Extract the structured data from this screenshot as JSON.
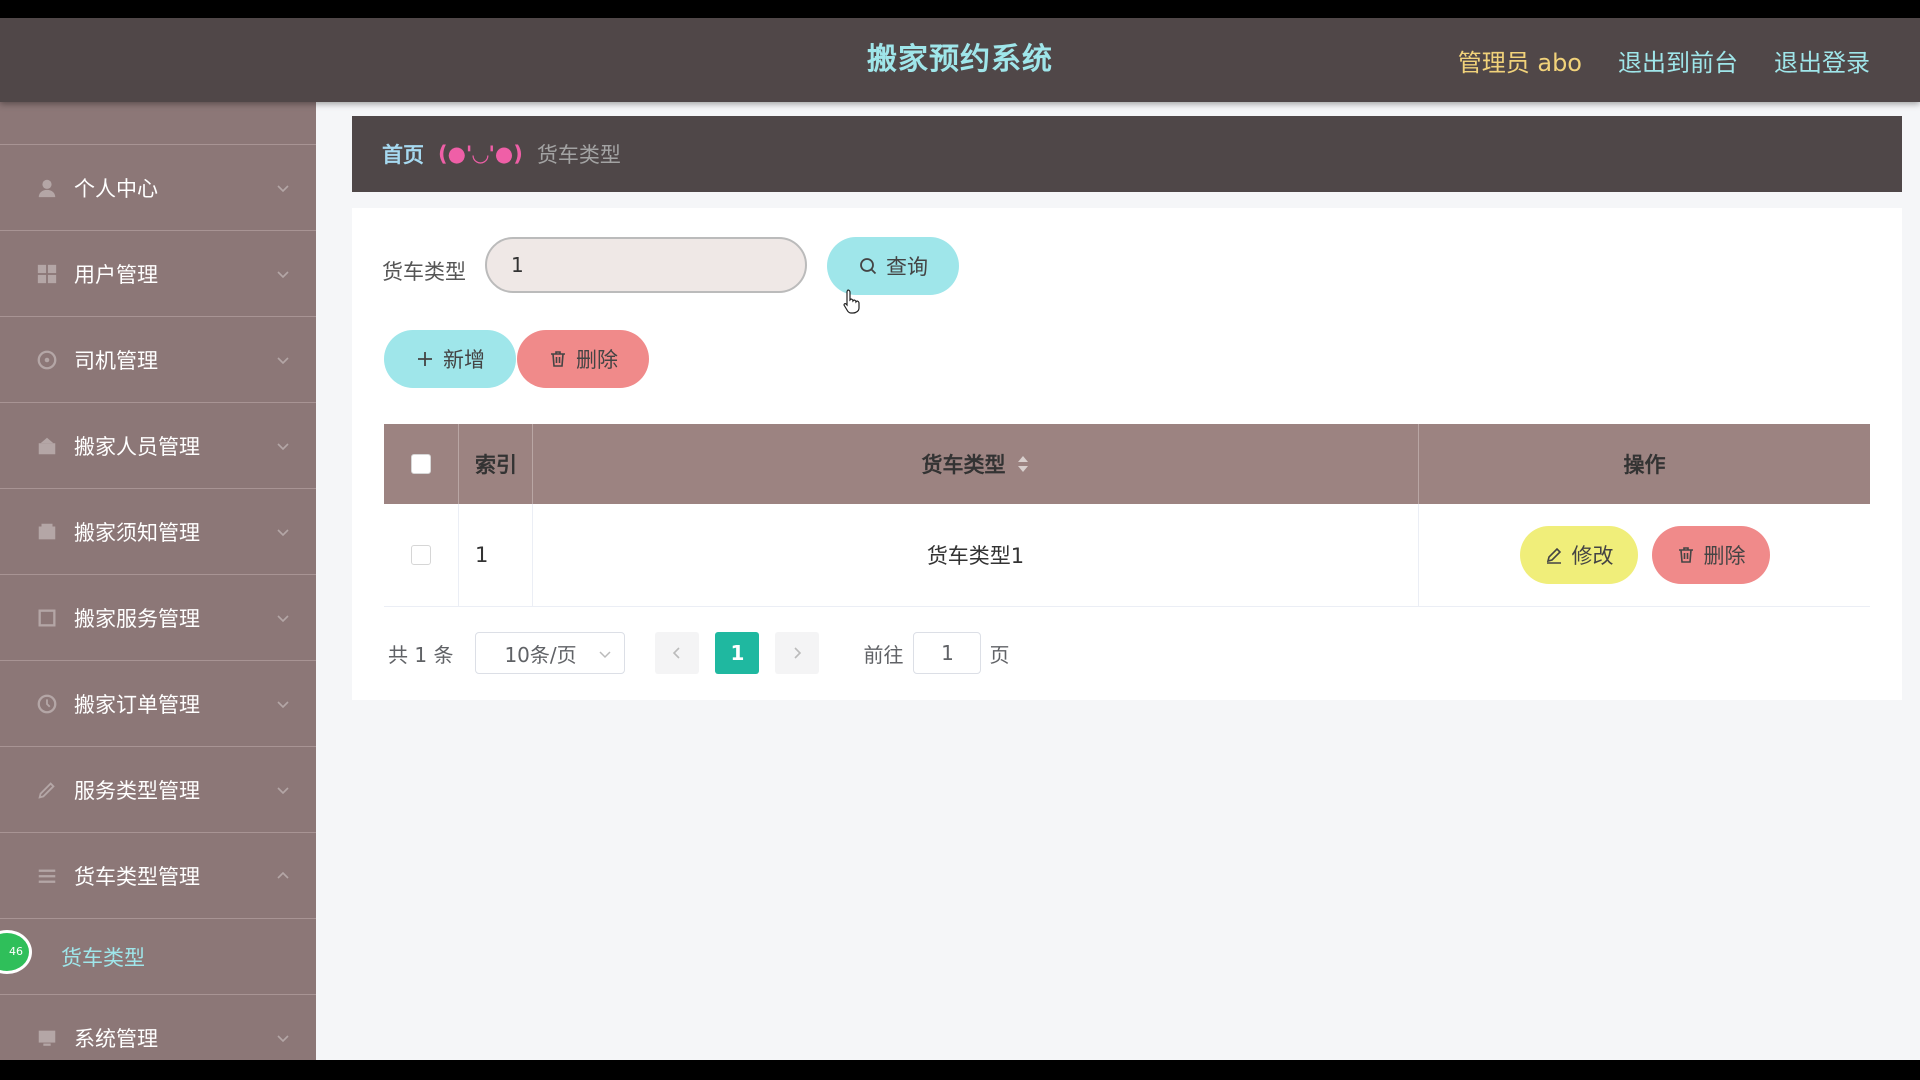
{
  "header": {
    "title": "搬家预约系统",
    "admin_label": "管理员 abo",
    "front_link": "退出到前台",
    "logout_link": "退出登录"
  },
  "sidebar": {
    "items": [
      {
        "label": "个人中心",
        "icon": "user-icon"
      },
      {
        "label": "用户管理",
        "icon": "grid-icon"
      },
      {
        "label": "司机管理",
        "icon": "steering-icon"
      },
      {
        "label": "搬家人员管理",
        "icon": "worker-icon"
      },
      {
        "label": "搬家须知管理",
        "icon": "notice-icon"
      },
      {
        "label": "搬家服务管理",
        "icon": "service-icon"
      },
      {
        "label": "搬家订单管理",
        "icon": "order-icon"
      },
      {
        "label": "服务类型管理",
        "icon": "tag-icon"
      },
      {
        "label": "货车类型管理",
        "icon": "list-icon"
      },
      {
        "label": "系统管理",
        "icon": "system-icon"
      }
    ],
    "active_submenu": "货车类型",
    "badge": "46"
  },
  "breadcrumb": {
    "home": "首页",
    "face": "(●'◡'●)",
    "current": "货车类型"
  },
  "search": {
    "label": "货车类型",
    "value": "1",
    "query_button": "查询"
  },
  "actions": {
    "add_button": "新增",
    "delete_button": "删除"
  },
  "table": {
    "columns": [
      "索引",
      "货车类型",
      "操作"
    ],
    "rows": [
      {
        "index": "1",
        "type": "货车类型1",
        "edit": "修改",
        "delete": "删除"
      }
    ]
  },
  "pagination": {
    "total": "共 1 条",
    "page_size": "10条/页",
    "current_page": "1",
    "goto_label": "前往",
    "goto_value": "1",
    "page_suffix": "页"
  },
  "colors": {
    "accent": "#9fe6ea",
    "danger": "#f08a8a",
    "warning": "#f0ee7a",
    "header_bg": "#504748",
    "sidebar_bg": "#8c7777",
    "table_header_bg": "#9c8381",
    "pager_active": "#1fb8a0"
  }
}
